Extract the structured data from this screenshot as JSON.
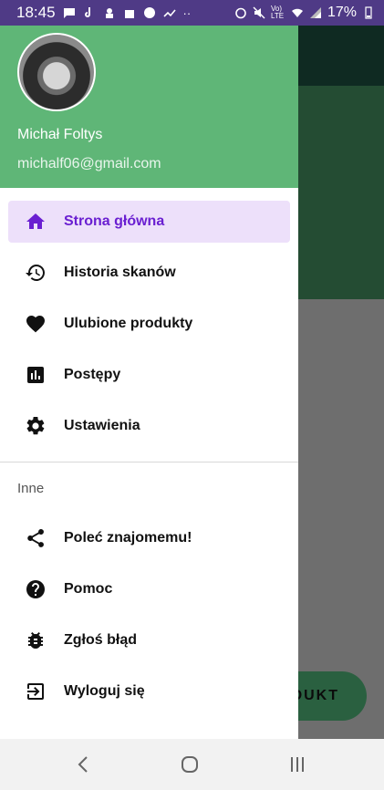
{
  "status_bar": {
    "time": "18:45",
    "battery_percent": "17%",
    "network": "Vo) LTE"
  },
  "drawer": {
    "user": {
      "name": "Michał Foltys",
      "email": "michalf06@gmail.com"
    },
    "main_items": [
      {
        "label": "Strona główna",
        "icon": "home-icon",
        "active": true
      },
      {
        "label": "Historia skanów",
        "icon": "history-icon",
        "active": false
      },
      {
        "label": "Ulubione produkty",
        "icon": "heart-icon",
        "active": false
      },
      {
        "label": "Postępy",
        "icon": "bar-chart-icon",
        "active": false
      },
      {
        "label": "Ustawienia",
        "icon": "gear-icon",
        "active": false
      }
    ],
    "section_title": "Inne",
    "other_items": [
      {
        "label": "Poleć znajomemu!",
        "icon": "share-icon"
      },
      {
        "label": "Pomoc",
        "icon": "help-icon"
      },
      {
        "label": "Zgłoś błąd",
        "icon": "bug-icon"
      },
      {
        "label": "Wyloguj się",
        "icon": "logout-icon"
      }
    ]
  },
  "background": {
    "fab_label_partial": "DUKT"
  },
  "colors": {
    "header": "#5fb677",
    "accent": "#6a1fd1",
    "active_bg": "#ede0fa",
    "status_bar": "#4f3a86"
  }
}
